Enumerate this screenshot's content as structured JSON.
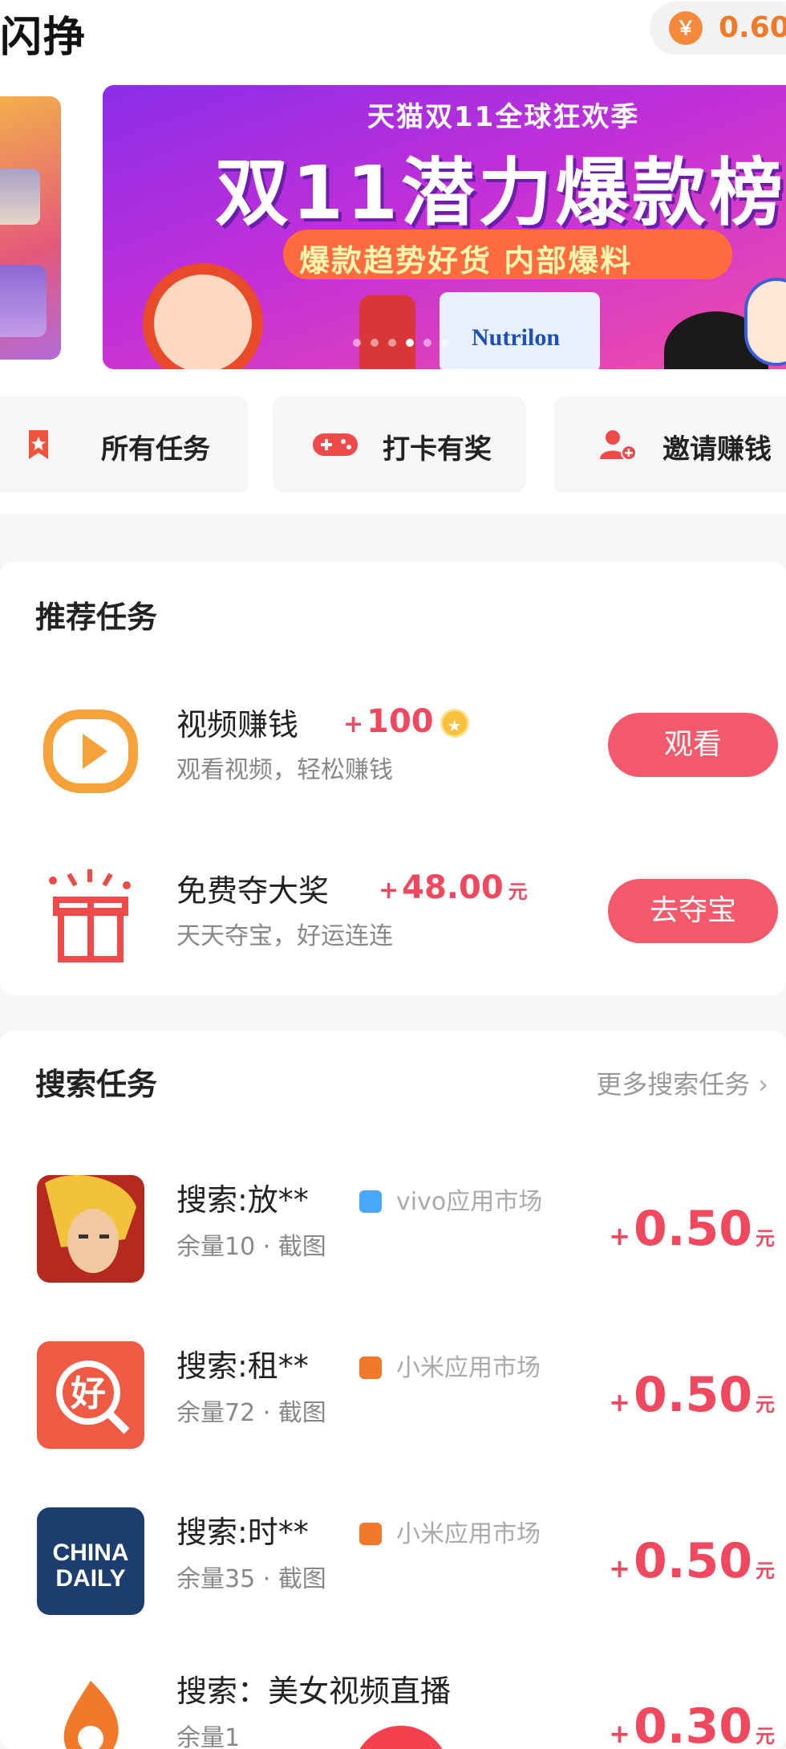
{
  "header": {
    "title": "闪挣",
    "balance_icon": "￥",
    "balance": "0.60"
  },
  "banner": {
    "top_line": "天猫双11全球狂欢季",
    "headline": "双11潜力爆款榜",
    "ribbon": "爆款趋势好货 内部爆料",
    "product_label": "Nutrilon"
  },
  "quick_entries": [
    {
      "label": "所有任务",
      "icon": "bookmark-star-icon",
      "color": "#f0533c"
    },
    {
      "label": "打卡有奖",
      "icon": "gamepad-icon",
      "color": "#ef4a4a"
    },
    {
      "label": "邀请赚钱",
      "icon": "invite-user-icon",
      "color": "#ef4a4a"
    }
  ],
  "recommended": {
    "title": "推荐任务",
    "items": [
      {
        "name": "视频赚钱",
        "reward_plus": "+",
        "reward": "100",
        "reward_icon": "coin-icon",
        "desc": "观看视频，轻松赚钱",
        "button": "观看",
        "icon": "play-video-icon"
      },
      {
        "name": "免费夺大奖",
        "reward_plus": "+",
        "reward": "48.00",
        "reward_unit": "元",
        "desc": "天天夺宝，好运连连",
        "button": "去夺宝",
        "icon": "gift-box-icon"
      }
    ]
  },
  "search_tasks": {
    "title": "搜索任务",
    "more": "更多搜索任务",
    "items": [
      {
        "name": "搜索:放**",
        "store": "vivo应用市场",
        "store_color": "#4aa8ff",
        "desc": "余量10 · 截图",
        "reward_plus": "+",
        "reward": "0.50",
        "reward_unit": "元",
        "icon": "game-hero-icon"
      },
      {
        "name": "搜索:租**",
        "store": "小米应用市场",
        "store_color": "#f07a2a",
        "desc": "余量72 · 截图",
        "reward_plus": "+",
        "reward": "0.50",
        "reward_unit": "元",
        "icon": "hao-app-icon"
      },
      {
        "name": "搜索:时**",
        "store": "小米应用市场",
        "store_color": "#f07a2a",
        "desc": "余量35 · 截图",
        "reward_plus": "+",
        "reward": "0.50",
        "reward_unit": "元",
        "icon": "china-daily-icon"
      },
      {
        "name": "搜索：美女视频直播",
        "store": "",
        "desc": "余量1",
        "reward_plus": "+",
        "reward": "0.30",
        "reward_unit": "元",
        "icon": "flame-app-icon"
      }
    ]
  },
  "china_daily_text": [
    "CHINA",
    "DAILY"
  ],
  "hao_text": "好",
  "brand_colors": {
    "accent": "#f2596a",
    "reward": "#f0495f",
    "balance": "#f07a2a"
  }
}
